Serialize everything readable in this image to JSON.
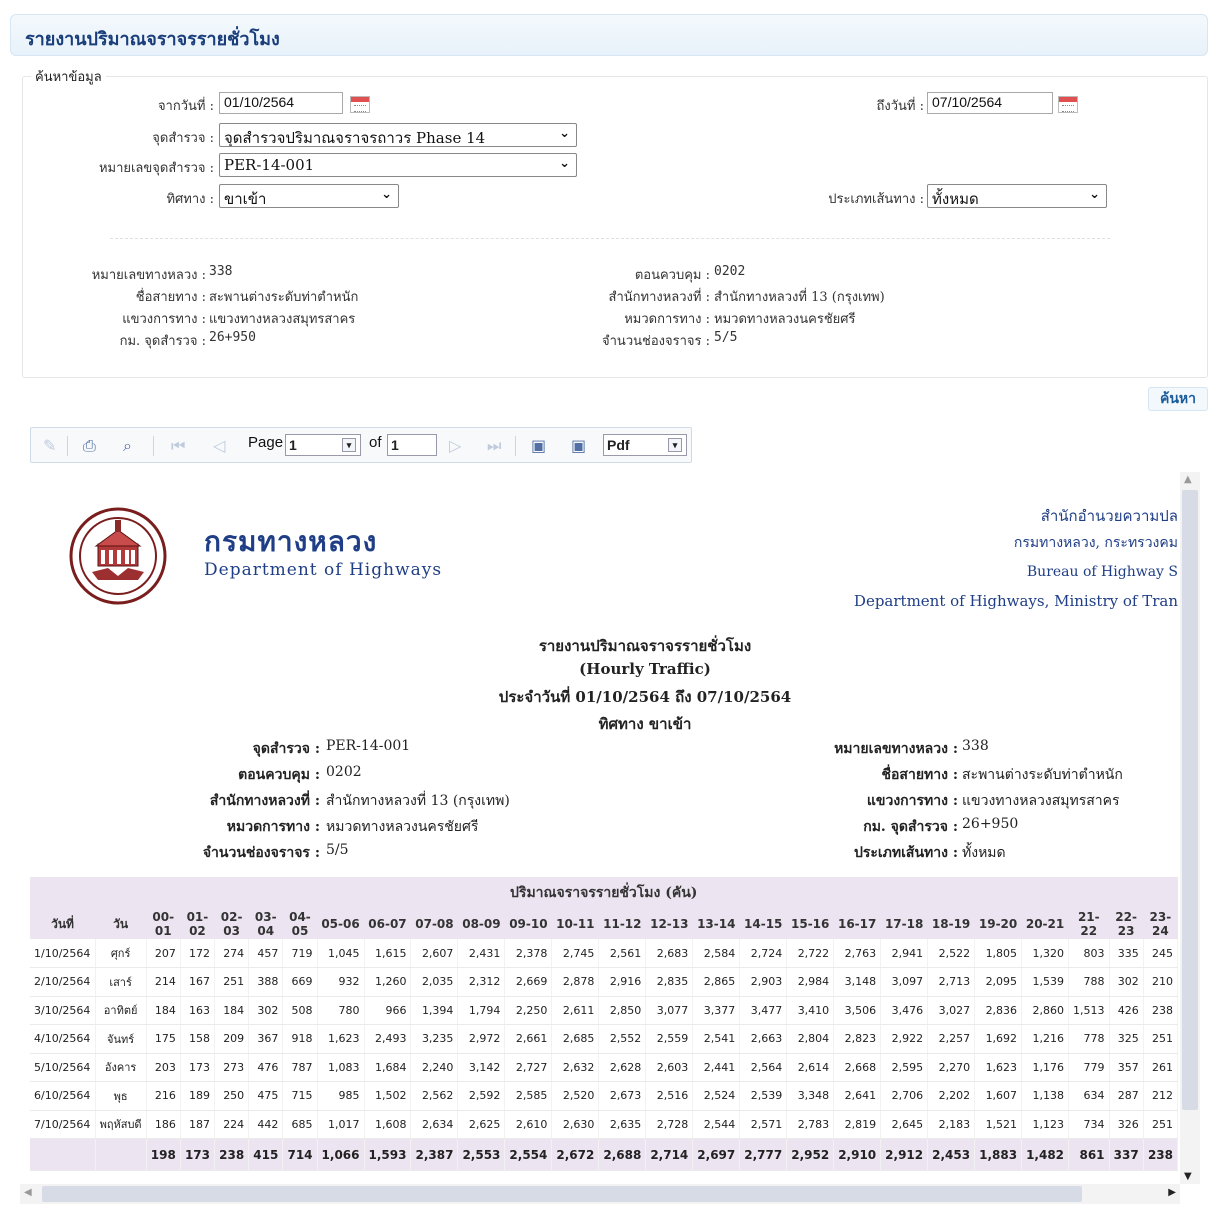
{
  "page_title": "รายงานปริมาณจราจรรายชั่วโมง",
  "search": {
    "legend": "ค้นหาข้อมูล",
    "from_label": "จากวันที่ :",
    "from_value": "01/10/2564",
    "to_label": "ถึงวันที่ :",
    "to_value": "07/10/2564",
    "station_label": "จุดสำรวจ :",
    "station_value": "จุดสำรวจปริมาณจราจรถาวร Phase 14",
    "station_no_label": "หมายเลขจุดสำรวจ :",
    "station_no_value": "PER-14-001",
    "direction_label": "ทิศทาง :",
    "direction_value": "ขาเข้า",
    "route_type_label": "ประเภทเส้นทาง :",
    "route_type_value": "ทั้งหมด",
    "info": {
      "highway_no_label": "หมายเลขทางหลวง :",
      "highway_no": "338",
      "route_name_label": "ชื่อสายทาง :",
      "route_name": "สะพานต่างระดับท่าตำหนัก",
      "district_label": "แขวงการทาง :",
      "district": "แขวงทางหลวงสมุทรสาคร",
      "km_label": "กม. จุดสำรวจ :",
      "km": "26+950",
      "control_label": "ตอนควบคุม :",
      "control": "0202",
      "bureau_label": "สำนักทางหลวงที่ :",
      "bureau": "สำนักทางหลวงที่ 13 (กรุงเทพ)",
      "unit_label": "หมวดการทาง :",
      "unit": "หมวดทางหลวงนครชัยศรี",
      "lanes_label": "จำนวนช่องจราจร :",
      "lanes": "5/5"
    },
    "button_label": "ค้นหา"
  },
  "toolbar": {
    "page_label": "Page",
    "page_value": "1",
    "of_label": "of",
    "of_value": "1",
    "format_value": "Pdf"
  },
  "report": {
    "dept_th": "กรมทางหลวง",
    "dept_en": "Department of Highways",
    "right_header": [
      "สำนักอำนวยความปล",
      "กรมทางหลวง, กระทรวงคม",
      "Bureau of Highway S",
      "Department of Highways, Ministry of Tran"
    ],
    "title1": "รายงานปริมาณจราจรรายชั่วโมง",
    "title2": "(Hourly Traffic)",
    "title3": "ประจำวันที่ 01/10/2564 ถึง 07/10/2564",
    "title4": "ทิศทาง ขาเข้า",
    "left_info": [
      {
        "label": "จุดสำรวจ :",
        "value": "PER-14-001"
      },
      {
        "label": "ตอนควบคุม :",
        "value": "0202"
      },
      {
        "label": "สำนักทางหลวงที่ :",
        "value": "สำนักทางหลวงที่ 13 (กรุงเทพ)"
      },
      {
        "label": "หมวดการทาง :",
        "value": "หมวดทางหลวงนครชัยศรี"
      },
      {
        "label": "จำนวนช่องจราจร :",
        "value": "5/5"
      }
    ],
    "right_info": [
      {
        "label": "หมายเลขทางหลวง :",
        "value": "338"
      },
      {
        "label": "ชื่อสายทาง :",
        "value": "สะพานต่างระดับท่าตำหนัก"
      },
      {
        "label": "แขวงการทาง :",
        "value": "แขวงทางหลวงสมุทรสาคร"
      },
      {
        "label": "กม. จุดสำรวจ :",
        "value": "26+950"
      },
      {
        "label": "ประเภทเส้นทาง :",
        "value": "ทั้งหมด"
      }
    ]
  },
  "chart_data": {
    "type": "table",
    "title": "ปริมาณจราจรรายชั่วโมง (คัน)",
    "columns": [
      "วันที่",
      "วัน",
      "00-01",
      "01-02",
      "02-03",
      "03-04",
      "04-05",
      "05-06",
      "06-07",
      "07-08",
      "08-09",
      "09-10",
      "10-11",
      "11-12",
      "12-13",
      "13-14",
      "14-15",
      "15-16",
      "16-17",
      "17-18",
      "18-19",
      "19-20",
      "20-21",
      "21-22",
      "22-23",
      "23-24"
    ],
    "rows": [
      [
        "1/10/2564",
        "ศุกร์",
        "207",
        "172",
        "274",
        "457",
        "719",
        "1,045",
        "1,615",
        "2,607",
        "2,431",
        "2,378",
        "2,745",
        "2,561",
        "2,683",
        "2,584",
        "2,724",
        "2,722",
        "2,763",
        "2,941",
        "2,522",
        "1,805",
        "1,320",
        "803",
        "335",
        "245"
      ],
      [
        "2/10/2564",
        "เสาร์",
        "214",
        "167",
        "251",
        "388",
        "669",
        "932",
        "1,260",
        "2,035",
        "2,312",
        "2,669",
        "2,878",
        "2,916",
        "2,835",
        "2,865",
        "2,903",
        "2,984",
        "3,148",
        "3,097",
        "2,713",
        "2,095",
        "1,539",
        "788",
        "302",
        "210"
      ],
      [
        "3/10/2564",
        "อาทิตย์",
        "184",
        "163",
        "184",
        "302",
        "508",
        "780",
        "966",
        "1,394",
        "1,794",
        "2,250",
        "2,611",
        "2,850",
        "3,077",
        "3,377",
        "3,477",
        "3,410",
        "3,506",
        "3,476",
        "3,027",
        "2,836",
        "2,860",
        "1,513",
        "426",
        "238"
      ],
      [
        "4/10/2564",
        "จันทร์",
        "175",
        "158",
        "209",
        "367",
        "918",
        "1,623",
        "2,493",
        "3,235",
        "2,972",
        "2,661",
        "2,685",
        "2,552",
        "2,559",
        "2,541",
        "2,663",
        "2,804",
        "2,823",
        "2,922",
        "2,257",
        "1,692",
        "1,216",
        "778",
        "325",
        "251"
      ],
      [
        "5/10/2564",
        "อังคาร",
        "203",
        "173",
        "273",
        "476",
        "787",
        "1,083",
        "1,684",
        "2,240",
        "3,142",
        "2,727",
        "2,632",
        "2,628",
        "2,603",
        "2,441",
        "2,564",
        "2,614",
        "2,668",
        "2,595",
        "2,270",
        "1,623",
        "1,176",
        "779",
        "357",
        "261"
      ],
      [
        "6/10/2564",
        "พุธ",
        "216",
        "189",
        "250",
        "475",
        "715",
        "985",
        "1,502",
        "2,562",
        "2,592",
        "2,585",
        "2,520",
        "2,673",
        "2,516",
        "2,524",
        "2,539",
        "3,348",
        "2,641",
        "2,706",
        "2,202",
        "1,607",
        "1,138",
        "634",
        "287",
        "212"
      ],
      [
        "7/10/2564",
        "พฤหัสบดี",
        "186",
        "187",
        "224",
        "442",
        "685",
        "1,017",
        "1,608",
        "2,634",
        "2,625",
        "2,610",
        "2,630",
        "2,635",
        "2,728",
        "2,544",
        "2,571",
        "2,783",
        "2,819",
        "2,645",
        "2,183",
        "1,521",
        "1,123",
        "734",
        "326",
        "251"
      ]
    ],
    "totals": [
      "",
      "",
      "198",
      "173",
      "238",
      "415",
      "714",
      "1,066",
      "1,593",
      "2,387",
      "2,553",
      "2,554",
      "2,672",
      "2,688",
      "2,714",
      "2,697",
      "2,777",
      "2,952",
      "2,910",
      "2,912",
      "2,453",
      "1,883",
      "1,482",
      "861",
      "337",
      "238"
    ]
  }
}
